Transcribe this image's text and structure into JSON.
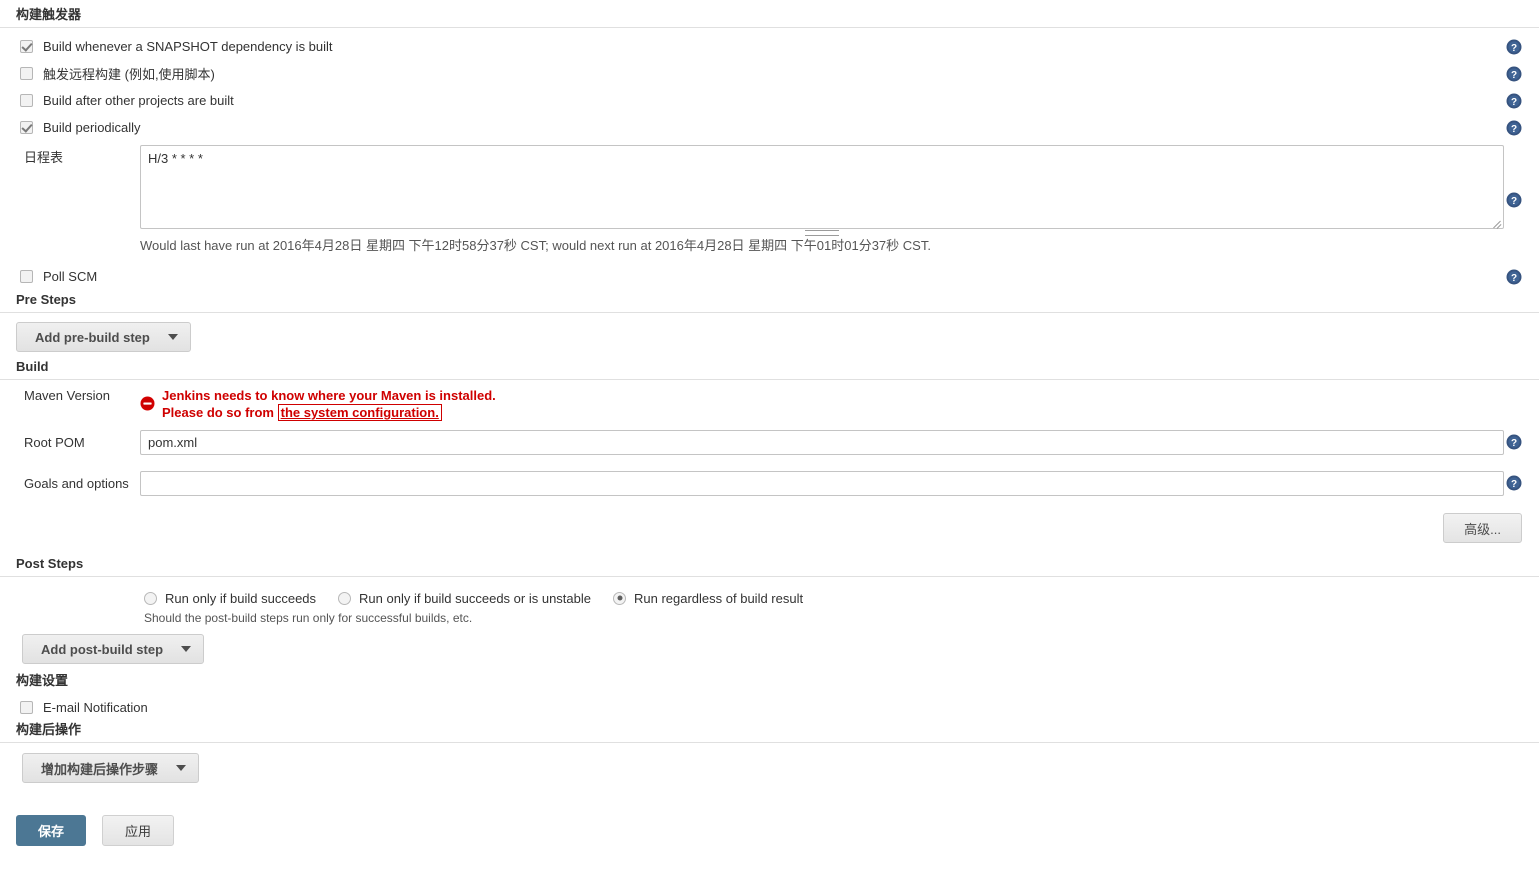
{
  "build_triggers": {
    "title": "构建触发器",
    "options": [
      {
        "label": "Build whenever a SNAPSHOT dependency is built",
        "checked": true
      },
      {
        "label": "触发远程构建 (例如,使用脚本)",
        "checked": false
      },
      {
        "label": "Build after other projects are built",
        "checked": false
      },
      {
        "label": "Build periodically",
        "checked": true
      }
    ],
    "schedule": {
      "label": "日程表",
      "value": "H/3 * * * *",
      "note": "Would last have run at 2016年4月28日 星期四 下午12时58分37秒 CST; would next run at 2016年4月28日 星期四 下午01时01分37秒 CST."
    },
    "poll_scm": {
      "label": "Poll SCM",
      "checked": false
    }
  },
  "pre_steps": {
    "title": "Pre Steps",
    "add_button": "Add pre-build step"
  },
  "build": {
    "title": "Build",
    "maven_version_label": "Maven Version",
    "error_line1": "Jenkins needs to know where your Maven is installed.",
    "error_line2_prefix": "Please do so from",
    "error_link": "the system configuration.",
    "root_pom_label": "Root POM",
    "root_pom_value": "pom.xml",
    "goals_label": "Goals and options",
    "goals_value": "",
    "advanced_button": "高级..."
  },
  "post_steps": {
    "title": "Post Steps",
    "radios": [
      {
        "label": "Run only if build succeeds",
        "selected": false
      },
      {
        "label": "Run only if build succeeds or is unstable",
        "selected": false
      },
      {
        "label": "Run regardless of build result",
        "selected": true
      }
    ],
    "hint": "Should the post-build steps run only for successful builds, etc.",
    "add_button": "Add post-build step"
  },
  "build_settings": {
    "title": "构建设置",
    "email_notification": {
      "label": "E-mail Notification",
      "checked": false
    }
  },
  "post_build_actions": {
    "title": "构建后操作",
    "add_button": "增加构建后操作步骤"
  },
  "footer": {
    "save": "保存",
    "apply": "应用"
  },
  "colors": {
    "help_icon": "#36537f",
    "error_red": "#cf0000",
    "save_blue": "#4c7794"
  }
}
